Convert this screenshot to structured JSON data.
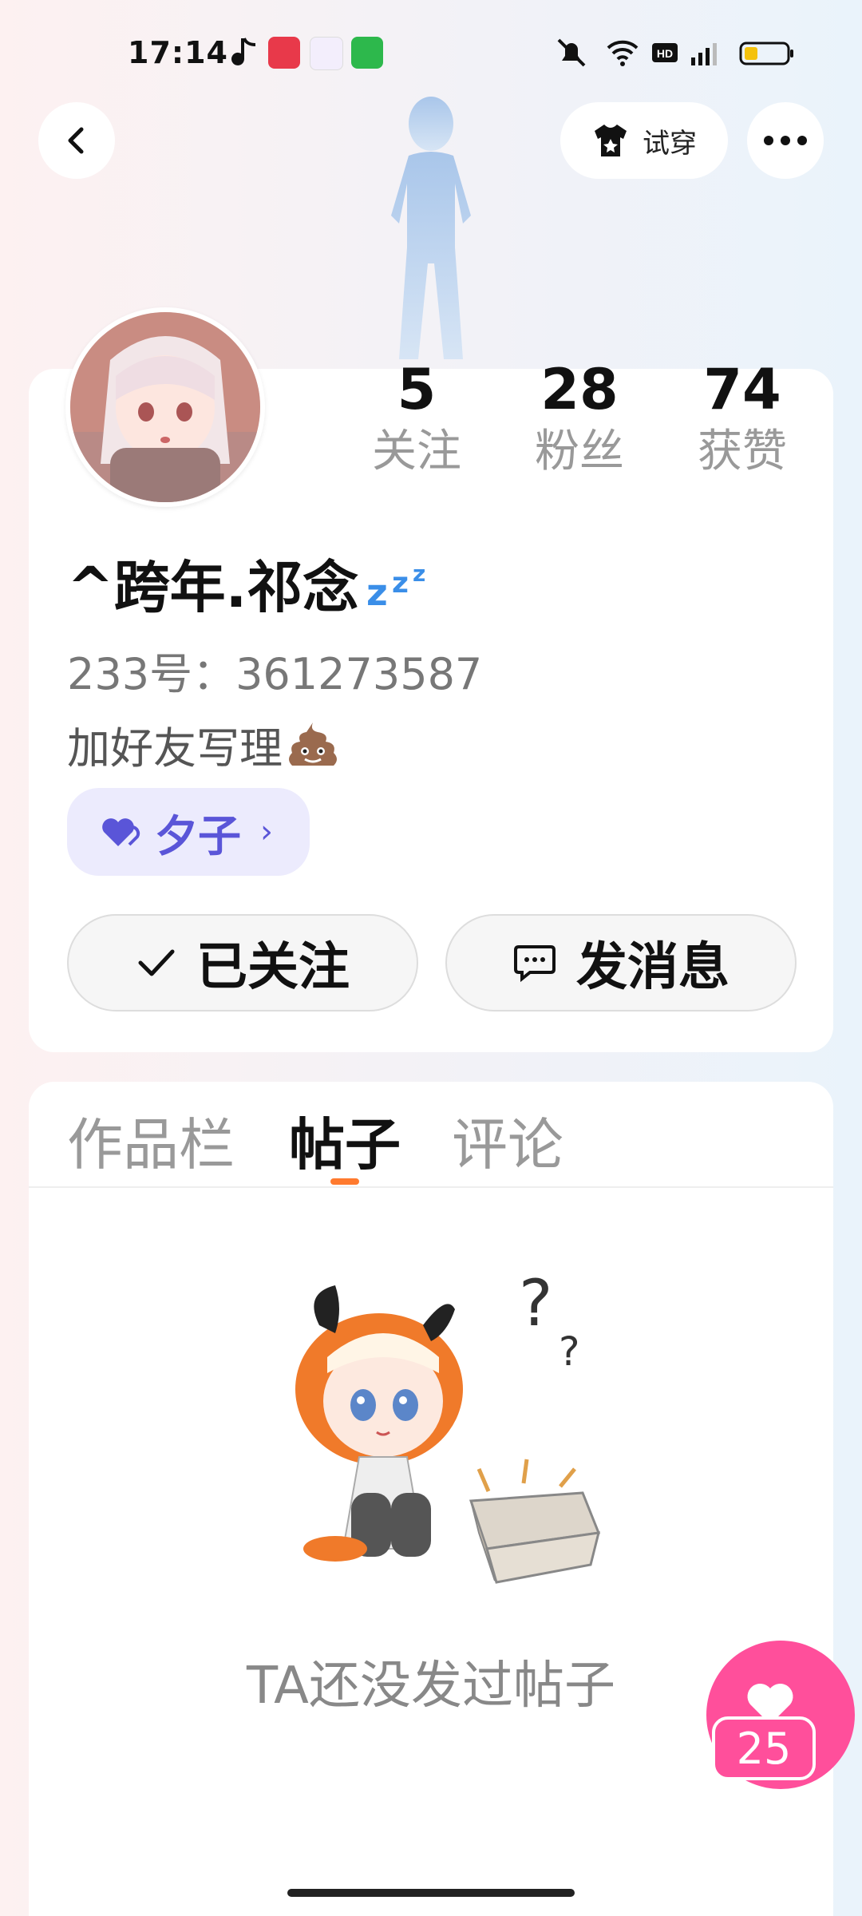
{
  "status_bar": {
    "time": "17:14"
  },
  "header": {
    "tryon_label": "试穿"
  },
  "profile": {
    "stats": [
      {
        "value": "5",
        "label": "关注"
      },
      {
        "value": "28",
        "label": "粉丝"
      },
      {
        "value": "74",
        "label": "获赞"
      }
    ],
    "name": "^跨年.祁念",
    "id_line": "233号：361273587",
    "bio": "加好友写理",
    "tag_label": "夕子",
    "follow_label": "已关注",
    "message_label": "发消息"
  },
  "tabs": [
    {
      "label": "作品栏"
    },
    {
      "label": "帖子"
    },
    {
      "label": "评论"
    }
  ],
  "empty_state": {
    "text": "TA还没发过帖子"
  },
  "like_button": {
    "count": "25"
  }
}
